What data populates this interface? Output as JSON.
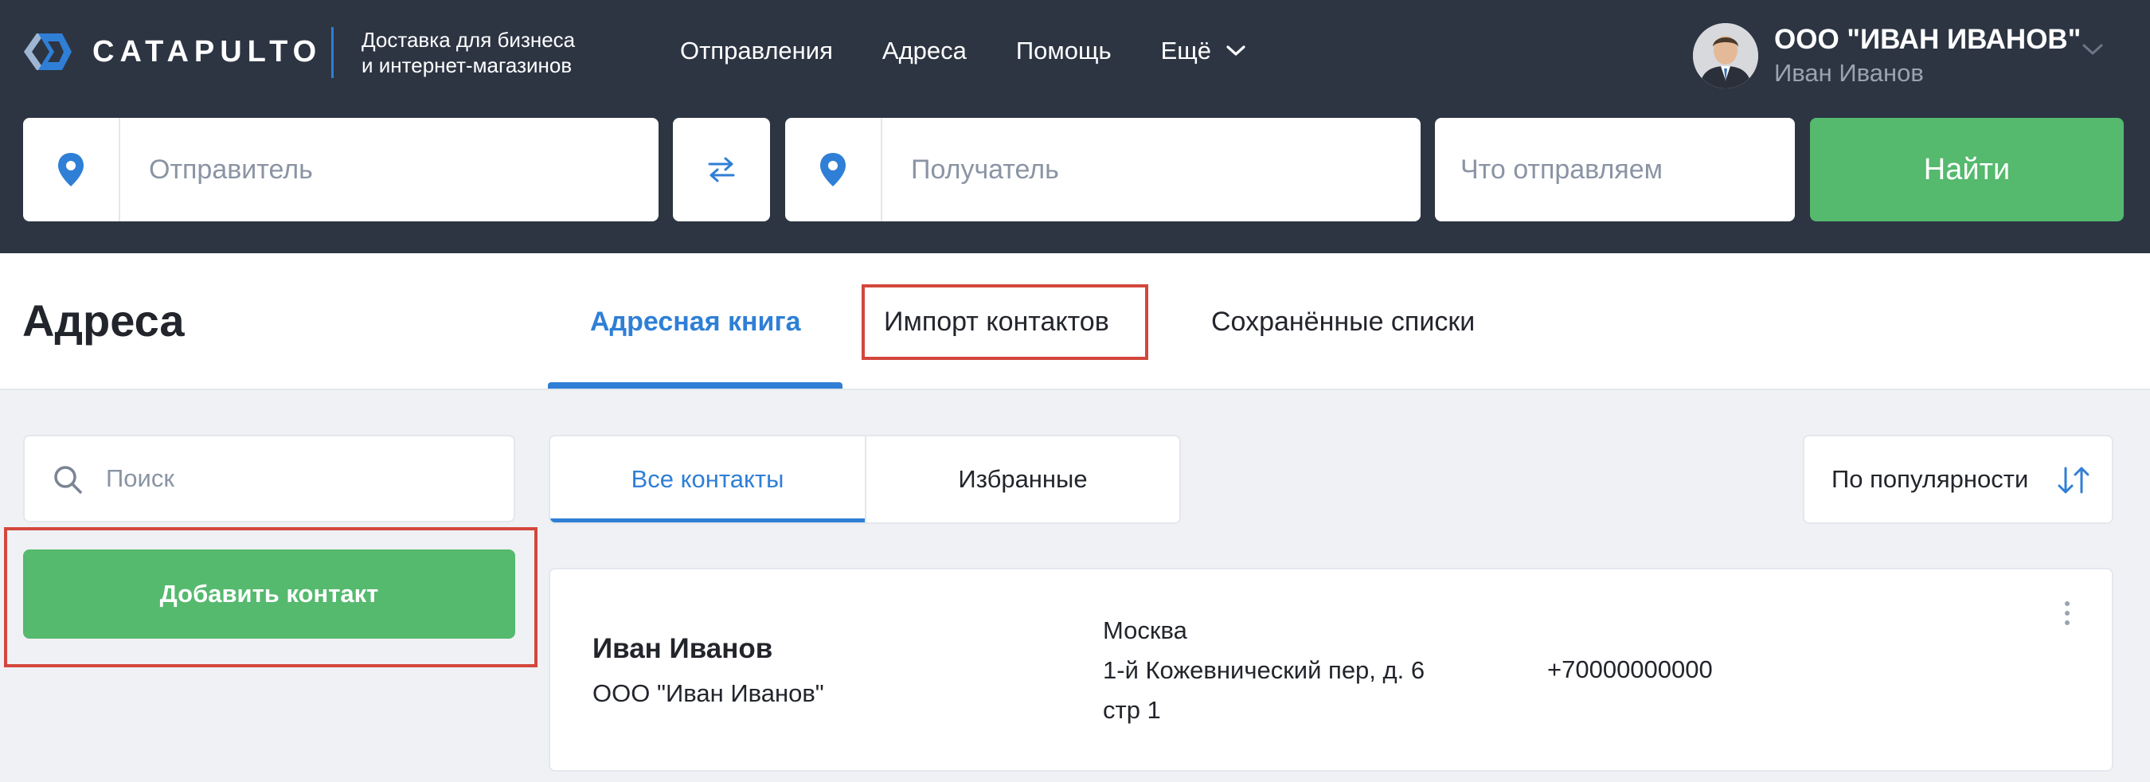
{
  "brand": {
    "name": "CATAPULTO",
    "tagline": [
      "Доставка для бизнеса",
      "и интернет-магазинов"
    ],
    "logo_icon": "catapulto-logo-icon"
  },
  "nav": {
    "items": [
      "Отправления",
      "Адреса",
      "Помощь"
    ],
    "more_label": "Ещё"
  },
  "user": {
    "company": "ООО \"ИВАН ИВАНОВ\"",
    "name": "Иван Иванов"
  },
  "search_bar": {
    "sender_placeholder": "Отправитель",
    "receiver_placeholder": "Получатель",
    "what_placeholder": "Что отправляем",
    "find_label": "Найти"
  },
  "page": {
    "title": "Адреса",
    "tabs": [
      {
        "label": "Адресная книга",
        "active": true
      },
      {
        "label": "Импорт контактов",
        "active": false
      },
      {
        "label": "Сохранённые списки",
        "active": false
      }
    ]
  },
  "sidebar": {
    "search_placeholder": "Поиск",
    "add_contact_label": "Добавить контакт"
  },
  "filters": {
    "segments": [
      {
        "label": "Все контакты",
        "active": true
      },
      {
        "label": "Избранные",
        "active": false
      }
    ],
    "sort_label": "По популярности"
  },
  "contacts": [
    {
      "name": "Иван Иванов",
      "company": "ООО \"Иван Иванов\"",
      "address_lines": [
        "Москва",
        "1-й Кожевнический пер, д. 6",
        "стр 1"
      ],
      "phone": "+70000000000"
    }
  ],
  "colors": {
    "header_bg": "#2d3543",
    "accent_blue": "#2f7fd6",
    "accent_green": "#55b96e",
    "highlight_red": "#d3473c",
    "page_bg": "#eff1f5"
  }
}
